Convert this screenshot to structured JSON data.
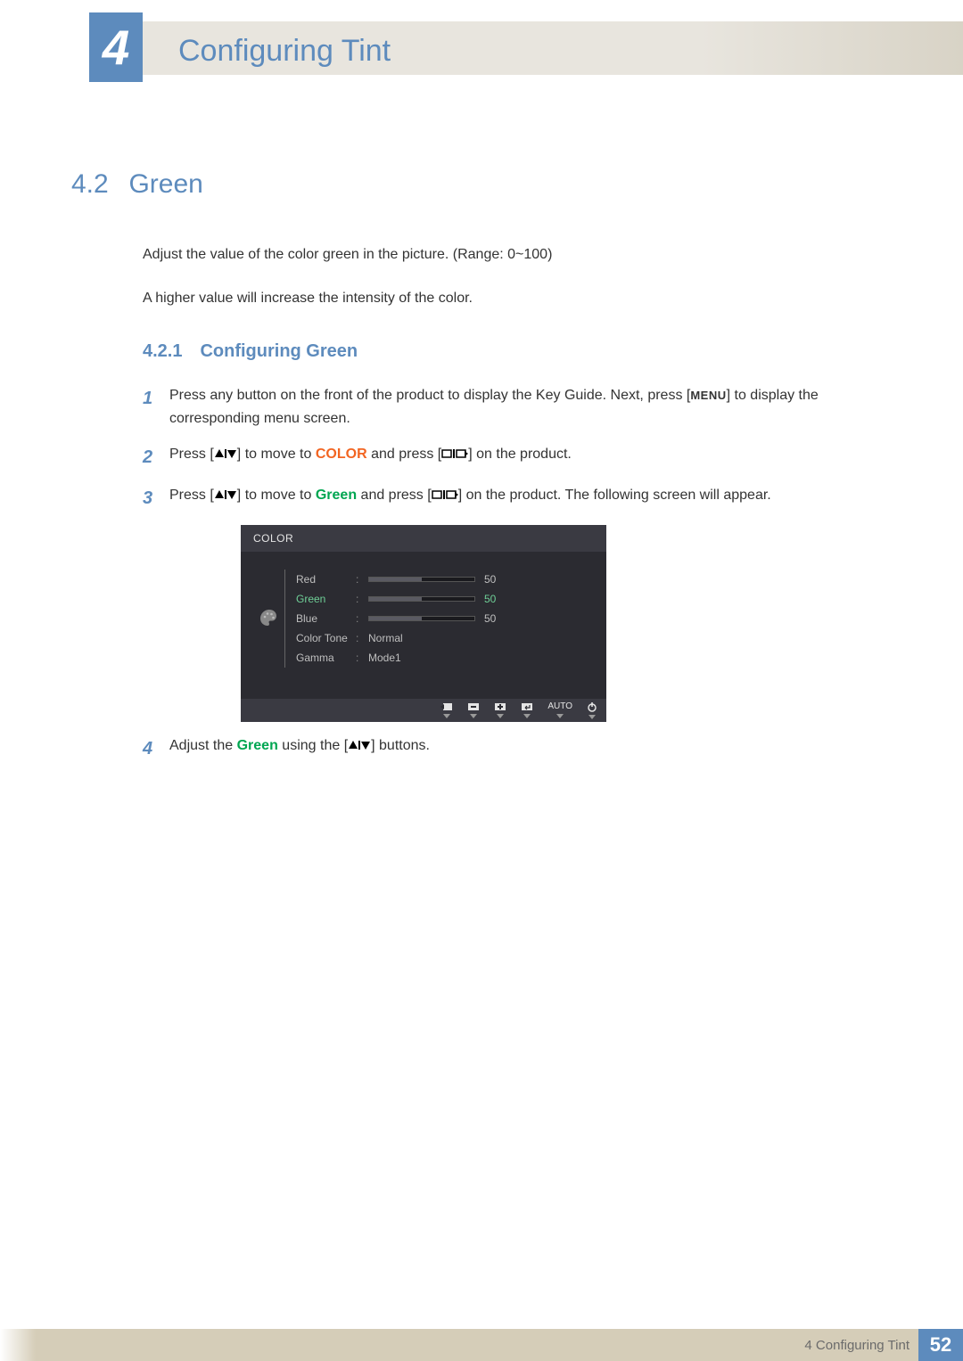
{
  "chapter": {
    "number": "4",
    "title": "Configuring Tint"
  },
  "section": {
    "number": "4.2",
    "title": "Green"
  },
  "intro": {
    "p1": "Adjust the value of the color green in the picture. (Range: 0~100)",
    "p2": "A higher value will increase the intensity of the color."
  },
  "subsection": {
    "number": "4.2.1",
    "title": "Configuring Green"
  },
  "steps": {
    "s1": {
      "num": "1",
      "pre": "Press any button on the front of the product to display the Key Guide. Next, press [",
      "menu": "MENU",
      "post": "] to display the corresponding menu screen."
    },
    "s2": {
      "num": "2",
      "t1": "Press [",
      "t2": "] to move to ",
      "color": "COLOR",
      "t3": " and press [",
      "t4": "] on the product."
    },
    "s3": {
      "num": "3",
      "t1": "Press [",
      "t2": "] to move to ",
      "green": "Green",
      "t3": " and press [",
      "t4": "] on the product. The following screen will appear."
    },
    "s4": {
      "num": "4",
      "t1": "Adjust the ",
      "green": "Green",
      "t2": " using the [",
      "t3": "] buttons."
    }
  },
  "osd": {
    "header": "COLOR",
    "rows": {
      "r0": {
        "label": "Red",
        "value": "50",
        "fill": 50
      },
      "r1": {
        "label": "Green",
        "value": "50",
        "fill": 50,
        "selected": true
      },
      "r2": {
        "label": "Blue",
        "value": "50",
        "fill": 50
      },
      "r3": {
        "label": "Color Tone",
        "value": "Normal"
      },
      "r4": {
        "label": "Gamma",
        "value": "Mode1"
      }
    },
    "footer": {
      "auto": "AUTO"
    }
  },
  "footer": {
    "text": "4 Configuring Tint",
    "page": "52"
  }
}
